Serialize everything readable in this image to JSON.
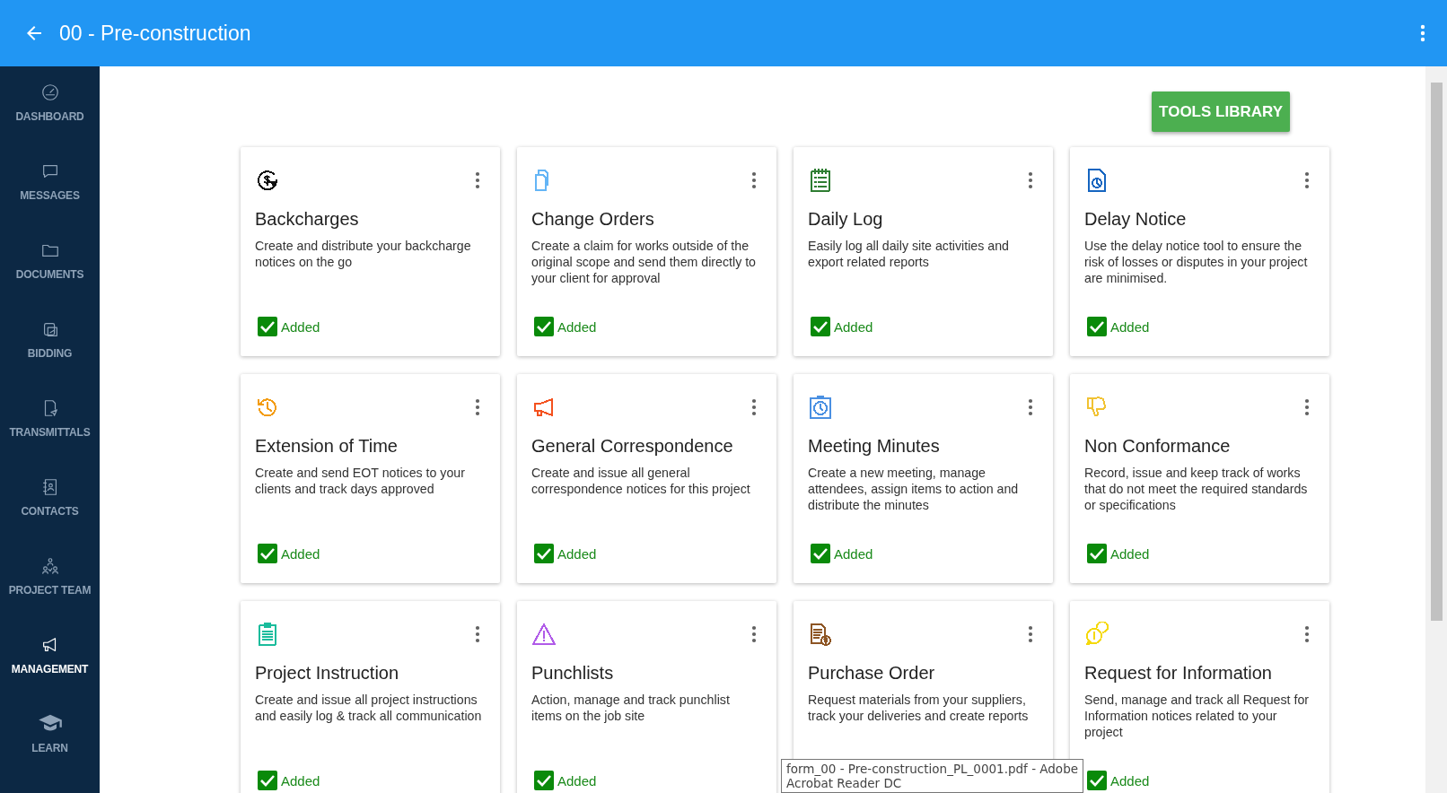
{
  "header": {
    "title": "00 - Pre-construction"
  },
  "sidebar": {
    "items": [
      {
        "label": "DASHBOARD",
        "kind": "gauge",
        "selected": false
      },
      {
        "label": "MESSAGES",
        "kind": "chat",
        "selected": false
      },
      {
        "label": "DOCUMENTS",
        "kind": "folder",
        "selected": false
      },
      {
        "label": "BIDDING",
        "kind": "bidding",
        "selected": false
      },
      {
        "label": "TRANSMITTALS",
        "kind": "send",
        "selected": false
      },
      {
        "label": "CONTACTS",
        "kind": "book",
        "selected": false
      },
      {
        "label": "PROJECT TEAM",
        "kind": "team",
        "selected": false
      },
      {
        "label": "MANAGEMENT",
        "kind": "megaphone",
        "selected": true
      },
      {
        "label": "LEARN",
        "kind": "cap",
        "selected": false
      }
    ]
  },
  "tools_button": "TOOLS LIBRARY",
  "tools": [
    {
      "title": "Backcharges",
      "description": "Create and distribute your backcharge notices on the go",
      "kind": "dollar",
      "color": "#111111",
      "status": "Added",
      "added": true
    },
    {
      "title": "Change Orders",
      "description": "Create a claim for works outside of the original scope and send them directly to your client for approval",
      "kind": "docs",
      "color": "#64b5f6",
      "status": "Added",
      "added": true
    },
    {
      "title": "Daily Log",
      "description": "Easily log all daily site activities and export related reports",
      "kind": "log",
      "color": "#2e7d32",
      "status": "Added",
      "added": true
    },
    {
      "title": "Delay Notice",
      "description": "Use the delay notice tool to ensure the risk of losses or disputes in your project are minimised.",
      "kind": "delay",
      "color": "#1565c0",
      "status": "Added",
      "added": true
    },
    {
      "title": "Extension of Time",
      "description": "Create and send EOT notices to your clients and track days approved",
      "kind": "history",
      "color": "#f39c12",
      "status": "Added",
      "added": true
    },
    {
      "title": "General Correspondence",
      "description": "Create and issue all general correspondence notices for this project",
      "kind": "megaphone",
      "color": "#f4511e",
      "status": "Added",
      "added": true
    },
    {
      "title": "Meeting Minutes",
      "description": "Create a new meeting, manage attendees, assign items to action and distribute the minutes",
      "kind": "timer",
      "color": "#4a90e2",
      "status": "Added",
      "added": true
    },
    {
      "title": "Non Conformance",
      "description": "Record, issue and keep track of works that do not meet the required standards or specifications",
      "kind": "thumbdown",
      "color": "#f1c232",
      "status": "Added",
      "added": true
    },
    {
      "title": "Project Instruction",
      "description": "Create and issue all project instructions and easily log & track all communication",
      "kind": "clipboard",
      "color": "#1abc9c",
      "status": "Added",
      "added": true
    },
    {
      "title": "Punchlists",
      "description": "Action, manage and track punchlist items on the job site",
      "kind": "warning",
      "color": "#b05be8",
      "status": "Added",
      "added": true
    },
    {
      "title": "Purchase Order",
      "description": "Request materials from your suppliers, track your deliveries and create reports",
      "kind": "invoice",
      "color": "#8d5524"
    },
    {
      "title": "Request for Information",
      "description": "Send, manage and track all Request for Information notices related to your project",
      "kind": "info",
      "color": "#f5d90a",
      "status": "Added",
      "added": true
    }
  ],
  "tooltip": {
    "lines": [
      "form_00 - Pre-construction_PL_0001.pdf - Adobe",
      "Acrobat Reader DC"
    ]
  }
}
